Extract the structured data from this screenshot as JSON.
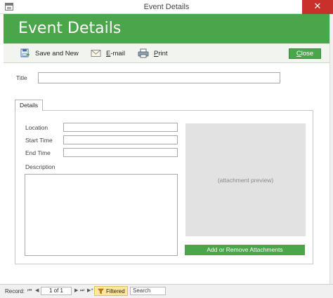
{
  "window": {
    "title": "Event Details",
    "close_glyph": "✕"
  },
  "header": {
    "title": "Event Details"
  },
  "toolbar": {
    "save_new_label": "Save and New",
    "email_label_underlined": "E",
    "email_label_rest": "-mail",
    "print_label_underlined": "P",
    "print_label_rest": "rint",
    "close_label_underlined": "C",
    "close_label_rest": "lose"
  },
  "form": {
    "title_label": "Title",
    "title_value": "",
    "tab_details": "Details",
    "location_label": "Location",
    "location_value": "",
    "start_time_label": "Start Time",
    "start_time_value": "",
    "end_time_label": "End Time",
    "end_time_value": "",
    "description_label": "Description",
    "description_value": "",
    "attachment_preview_text": "(attachment preview)",
    "attach_button_label": "Add or Remove Attachments"
  },
  "record_nav": {
    "record_label": "Record:",
    "first_glyph": "⏮",
    "prev_glyph": "◀",
    "position": "1 of 1",
    "next_glyph": "▶",
    "last_glyph": "⏭",
    "new_glyph": "▶*",
    "filter_label": "Filtered",
    "search_label": "Search"
  },
  "colors": {
    "accent_green": "#4ba54a",
    "close_red": "#c9302c",
    "filter_yellow": "#fde79a"
  },
  "icons": [
    "app-form-icon",
    "save-new-icon",
    "email-icon",
    "print-icon",
    "filter-icon"
  ]
}
